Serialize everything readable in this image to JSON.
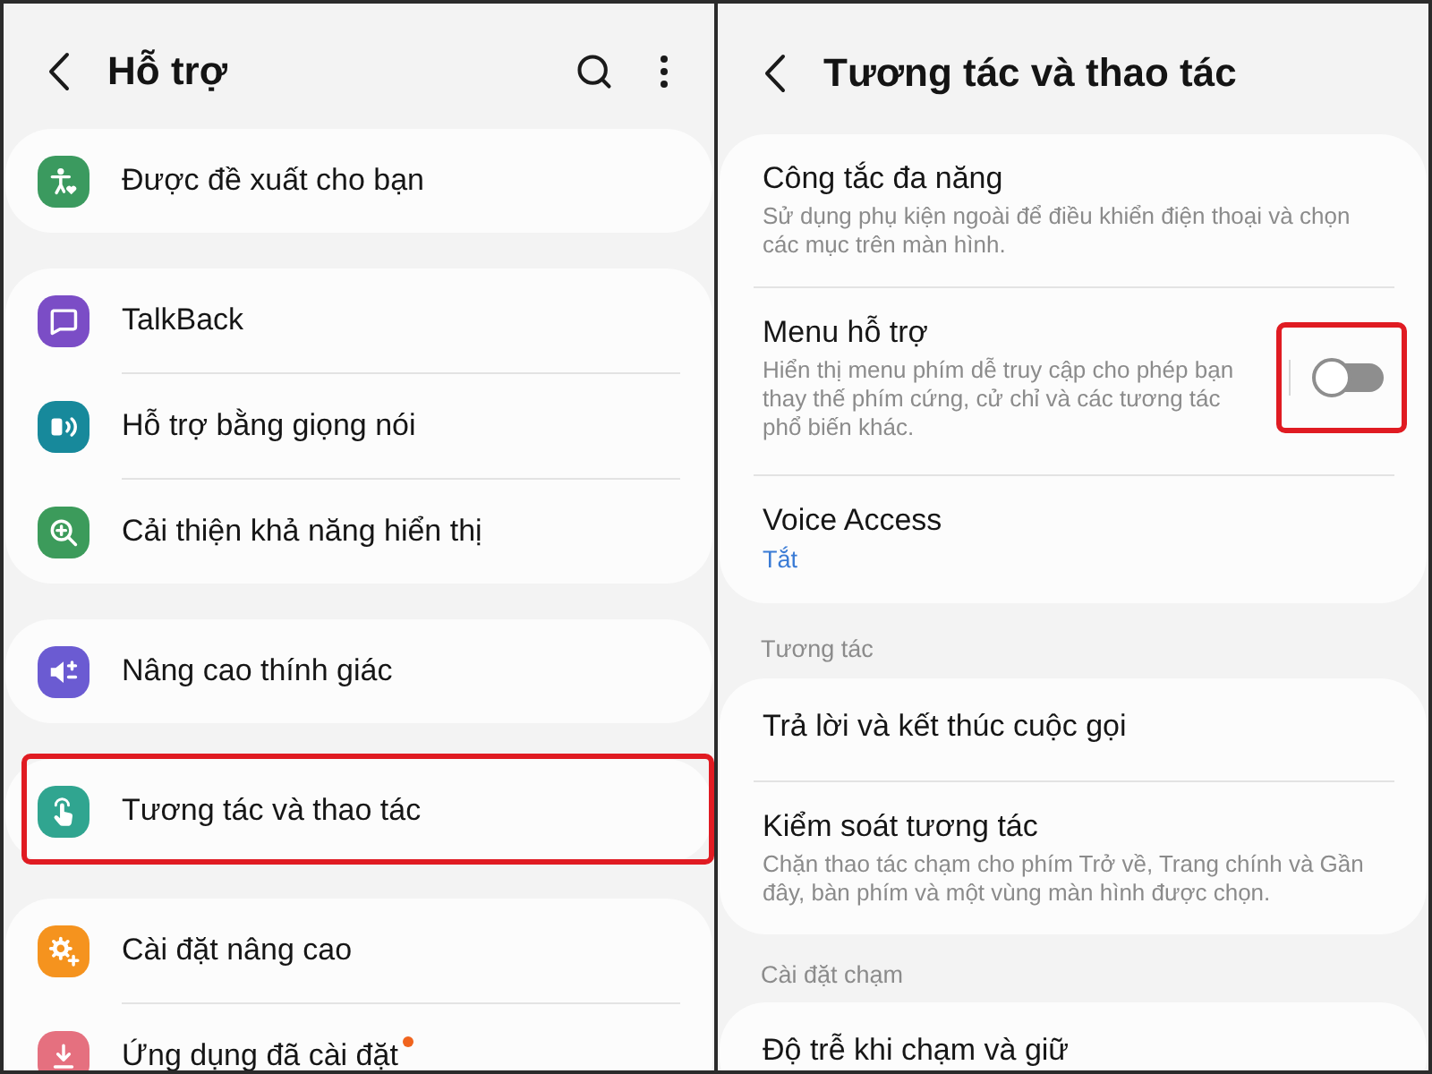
{
  "left_screen": {
    "title": "Hỗ trợ",
    "groups": [
      {
        "items": [
          {
            "label": "Được đề xuất cho bạn",
            "color": "#3b9a5f",
            "highlighted": false,
            "dot": false
          }
        ]
      },
      {
        "items": [
          {
            "label": "TalkBack",
            "color": "#7b4dc6",
            "highlighted": false,
            "dot": false
          },
          {
            "label": "Hỗ trợ bằng giọng nói",
            "color": "#17899b",
            "highlighted": false,
            "dot": false
          },
          {
            "label": "Cải thiện khả năng hiển thị",
            "color": "#3c9b5b",
            "highlighted": false,
            "dot": false
          }
        ]
      },
      {
        "items": [
          {
            "label": "Nâng cao thính giác",
            "color": "#6b5bd2",
            "highlighted": false,
            "dot": false
          }
        ]
      },
      {
        "items": [
          {
            "label": "Tương tác và thao tác",
            "color": "#30a590",
            "highlighted": true,
            "dot": false
          }
        ]
      },
      {
        "items": [
          {
            "label": "Cài đặt nâng cao",
            "color": "#f5931e",
            "highlighted": false,
            "dot": false
          },
          {
            "label": "Ứng dụng đã cài đặt",
            "color": "#e5707f",
            "highlighted": false,
            "dot": true
          }
        ]
      }
    ]
  },
  "right_screen": {
    "title": "Tương tác và thao tác",
    "groups": [
      {
        "items": [
          {
            "kind": "link",
            "title": "Công tắc đa năng",
            "description": "Sử dụng phụ kiện ngoài để điều khiển điện thoại và chọn các mục trên màn hình."
          },
          {
            "kind": "switch",
            "title": "Menu hỗ trợ",
            "description": "Hiển thị menu phím dễ truy cập cho phép bạn thay thế phím cứng, cử chỉ và các tương tác phổ biến khác.",
            "on": false,
            "highlighted": true
          },
          {
            "kind": "link",
            "title": "Voice Access",
            "status": "Tắt"
          }
        ]
      },
      {
        "header": "Tương tác",
        "items": [
          {
            "kind": "link",
            "title": "Trả lời và kết thúc cuộc gọi"
          },
          {
            "kind": "link",
            "title": "Kiểm soát tương tác",
            "description": "Chặn thao tác chạm cho phím Trở về, Trang chính và Gần đây, bàn phím và một vùng màn hình được chọn."
          }
        ]
      },
      {
        "header": "Cài đặt chạm",
        "items": [
          {
            "kind": "link",
            "title": "Độ trễ khi chạm và giữ"
          }
        ]
      }
    ]
  }
}
